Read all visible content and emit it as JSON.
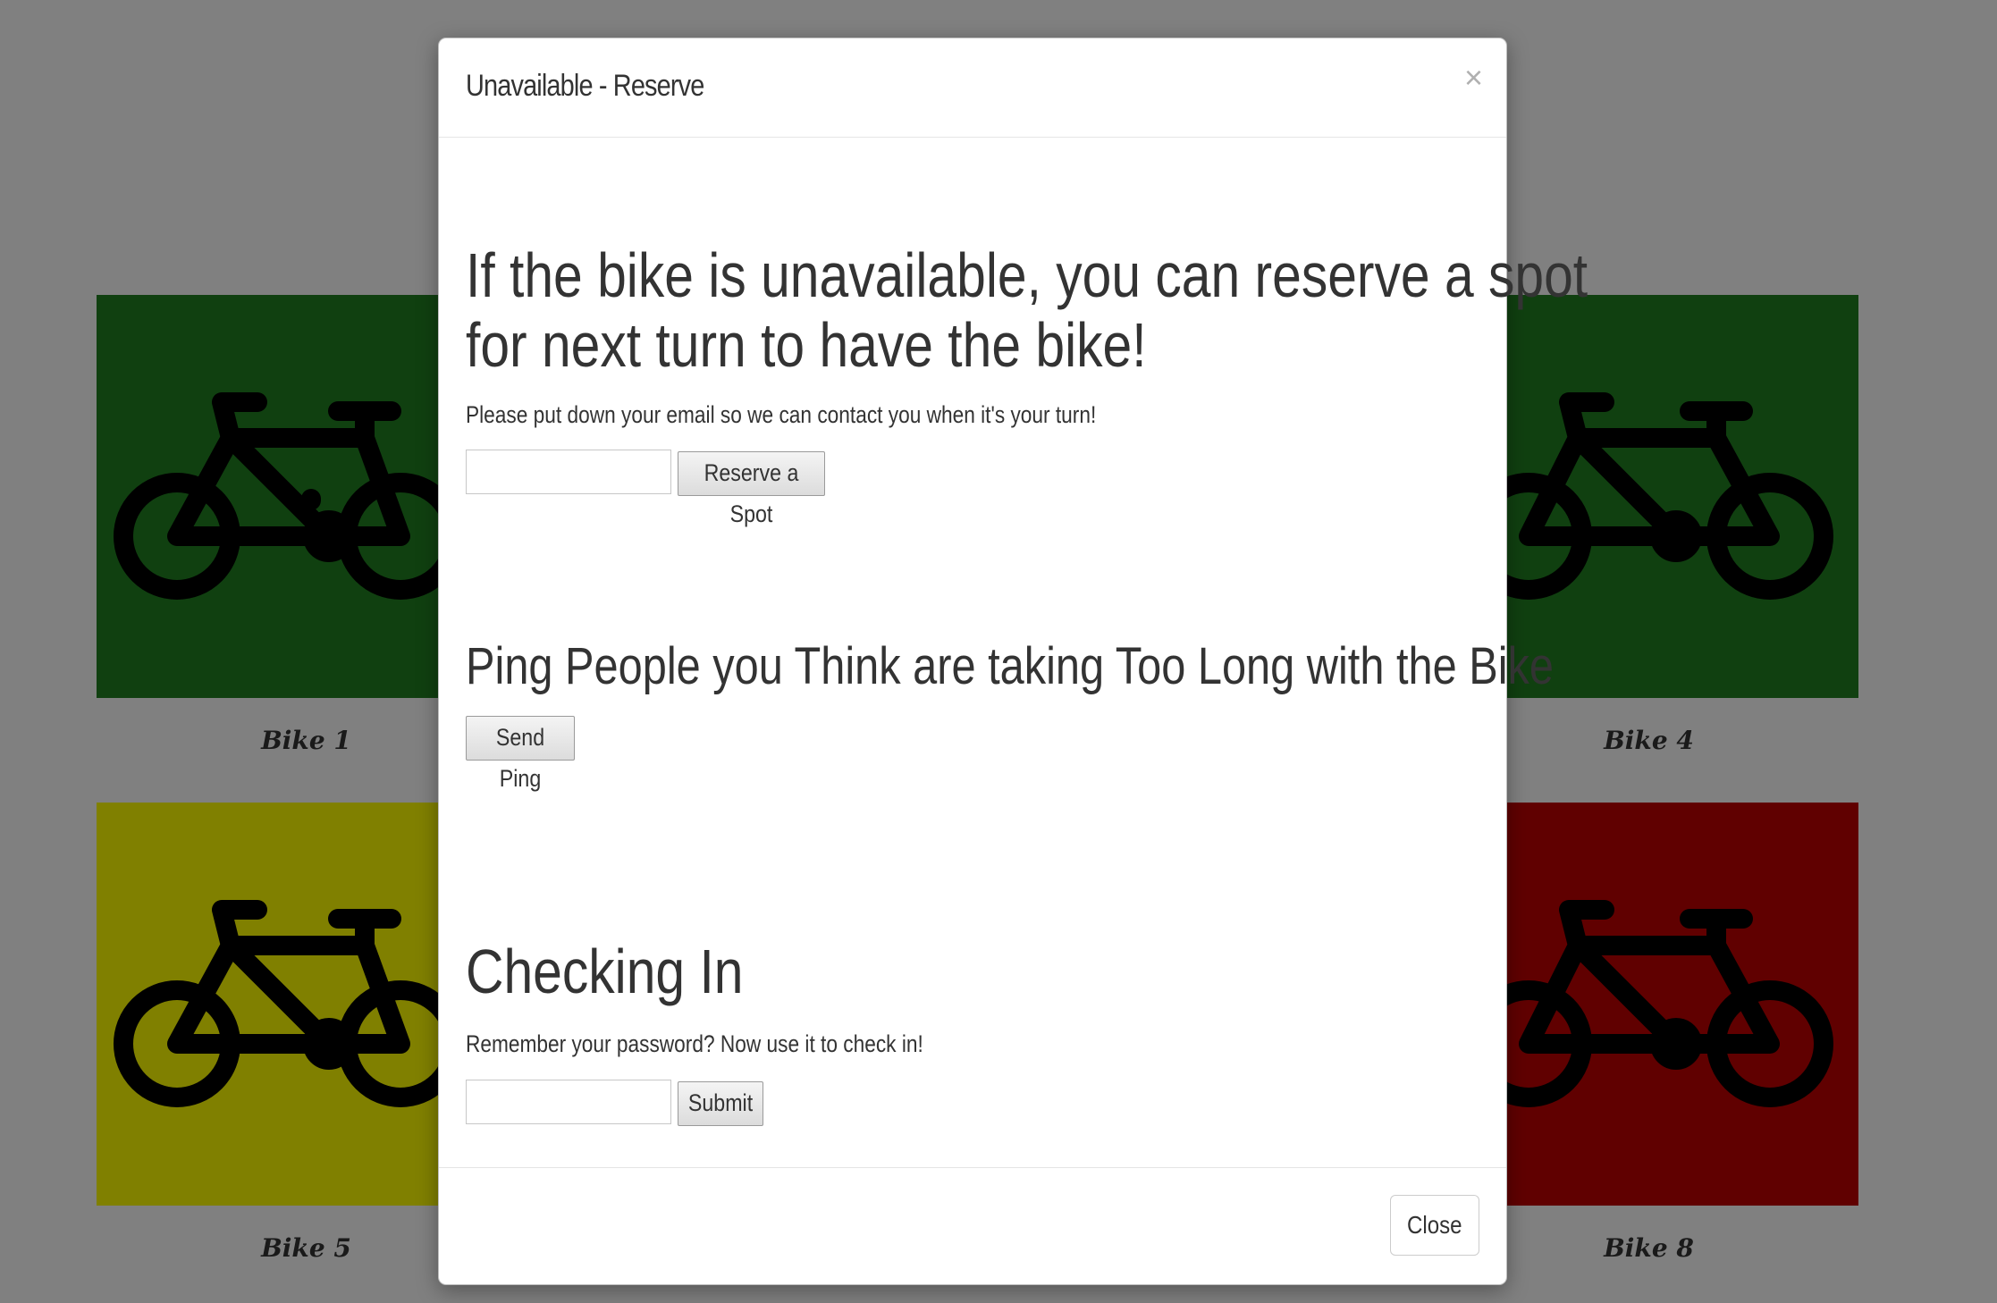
{
  "page": {
    "tiles": [
      {
        "label": "Bike 1",
        "color": "#104010",
        "status": "available"
      },
      {
        "label": "Bike 4",
        "color": "#104010",
        "status": "available"
      },
      {
        "label": "Bike 5",
        "color": "#808000",
        "status": "pending"
      },
      {
        "label": "Bike 8",
        "color": "#600000",
        "status": "unavailable"
      }
    ]
  },
  "modal": {
    "title": "Unavailable - Reserve",
    "close_icon": "×",
    "reserve": {
      "heading_line1": "If the bike is unavailable, you can reserve a spot",
      "heading_line2": "for next turn to have the bike!",
      "instruction": "Please put down your email so we can contact you when it's your turn!",
      "email_value": "",
      "button_label": "Reserve a Spot"
    },
    "ping": {
      "heading": "Ping People you Think are taking Too Long with the Bike",
      "button_label": "Send Ping"
    },
    "checkin": {
      "heading": "Checking In",
      "instruction": "Remember your password? Now use it to check in!",
      "password_value": "",
      "button_label": "Submit"
    },
    "footer": {
      "close_label": "Close"
    }
  }
}
